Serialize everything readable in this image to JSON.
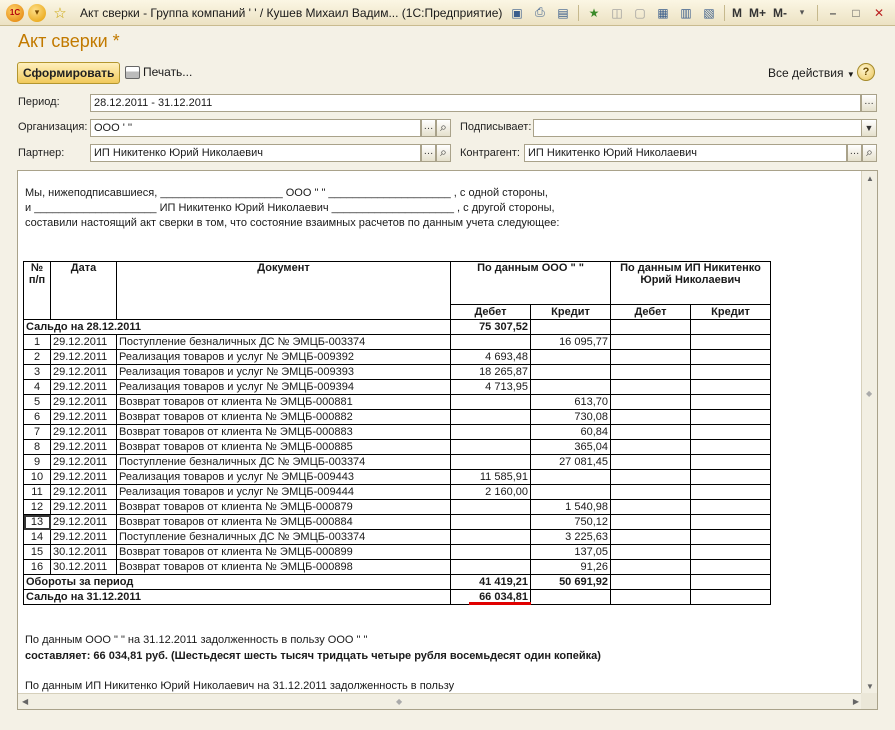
{
  "window": {
    "title": "Акт сверки - Группа компаний '                    ' / Кушев Михаил Вадим...   (1С:Предприятие)",
    "logo_text": "1С",
    "memory_buttons": [
      "M",
      "M+",
      "M-"
    ]
  },
  "form": {
    "title": "Акт сверки *",
    "generate_button": "Сформировать",
    "print_button": "Печать...",
    "all_actions": "Все действия",
    "help": "?"
  },
  "fields": {
    "period_label": "Период:",
    "period_value": "28.12.2011 - 31.12.2011",
    "org_label": "Организация:",
    "org_value": "ООО '                    ''",
    "signer_label": "Подписывает:",
    "signer_value": "",
    "partner_label": "Партнер:",
    "partner_value": "ИП Никитенко Юрий Николаевич",
    "contractor_label": "Контрагент:",
    "contractor_value": "ИП Никитенко Юрий Николаевич"
  },
  "report": {
    "intro": [
      "Мы, нижеподписавшиеся, ____________________ ООО \"                \" ____________________ , с одной стороны,",
      "и ____________________  ИП Никитенко Юрий Николаевич ____________________ , с другой стороны,",
      "составили настоящий акт сверки в том, что состояние взаимных расчетов по данным учета следующее:"
    ],
    "headers": {
      "num": "№ п/п",
      "date": "Дата",
      "doc": "Документ",
      "by_data_1": "По данным ООО \"                \"",
      "by_data_2": "По данным ИП Никитенко Юрий Николаевич",
      "debit": "Дебет",
      "credit": "Кредит"
    },
    "opening": {
      "label": "Сальдо на 28.12.2011",
      "debit": "75 307,52"
    },
    "rows": [
      {
        "n": "1",
        "date": "29.12.2011",
        "doc": "Поступление безналичных ДС  № ЭМЦБ-003374",
        "debit": "",
        "credit": "16 095,77"
      },
      {
        "n": "2",
        "date": "29.12.2011",
        "doc": "Реализация товаров и услуг  № ЭМЦБ-009392",
        "debit": "4 693,48",
        "credit": ""
      },
      {
        "n": "3",
        "date": "29.12.2011",
        "doc": "Реализация товаров и услуг  № ЭМЦБ-009393",
        "debit": "18 265,87",
        "credit": ""
      },
      {
        "n": "4",
        "date": "29.12.2011",
        "doc": "Реализация товаров и услуг  № ЭМЦБ-009394",
        "debit": "4 713,95",
        "credit": ""
      },
      {
        "n": "5",
        "date": "29.12.2011",
        "doc": "Возврат товаров от клиента  № ЭМЦБ-000881",
        "debit": "",
        "credit": "613,70"
      },
      {
        "n": "6",
        "date": "29.12.2011",
        "doc": "Возврат товаров от клиента  № ЭМЦБ-000882",
        "debit": "",
        "credit": "730,08"
      },
      {
        "n": "7",
        "date": "29.12.2011",
        "doc": "Возврат товаров от клиента  № ЭМЦБ-000883",
        "debit": "",
        "credit": "60,84"
      },
      {
        "n": "8",
        "date": "29.12.2011",
        "doc": "Возврат товаров от клиента  № ЭМЦБ-000885",
        "debit": "",
        "credit": "365,04"
      },
      {
        "n": "9",
        "date": "29.12.2011",
        "doc": "Поступление безналичных ДС  № ЭМЦБ-003374",
        "debit": "",
        "credit": "27 081,45"
      },
      {
        "n": "10",
        "date": "29.12.2011",
        "doc": "Реализация товаров и услуг  № ЭМЦБ-009443",
        "debit": "11 585,91",
        "credit": ""
      },
      {
        "n": "11",
        "date": "29.12.2011",
        "doc": "Реализация товаров и услуг  № ЭМЦБ-009444",
        "debit": "2 160,00",
        "credit": ""
      },
      {
        "n": "12",
        "date": "29.12.2011",
        "doc": "Возврат товаров от клиента  № ЭМЦБ-000879",
        "debit": "",
        "credit": "1 540,98"
      },
      {
        "n": "13",
        "date": "29.12.2011",
        "doc": "Возврат товаров от клиента  № ЭМЦБ-000884",
        "debit": "",
        "credit": "750,12"
      },
      {
        "n": "14",
        "date": "29.12.2011",
        "doc": "Поступление безналичных ДС  № ЭМЦБ-003374",
        "debit": "",
        "credit": "3 225,63"
      },
      {
        "n": "15",
        "date": "30.12.2011",
        "doc": "Возврат товаров от клиента  № ЭМЦБ-000899",
        "debit": "",
        "credit": "137,05"
      },
      {
        "n": "16",
        "date": "30.12.2011",
        "doc": "Возврат товаров от клиента  № ЭМЦБ-000898",
        "debit": "",
        "credit": "91,26"
      }
    ],
    "turnover": {
      "label": "Обороты за период",
      "debit": "41 419,21",
      "credit": "50 691,92"
    },
    "closing": {
      "label": "Сальдо на 31.12.2011",
      "debit": "66 034,81"
    },
    "footer": [
      "По данным ООО \"                \" на 31.12.2011 задолженность в пользу ООО \"                \"",
      "составляет: 66 034,81 руб. (Шестьдесят шесть тысяч тридцать четыре рубля восемьдесят один копейка)",
      "По данным ИП Никитенко Юрий Николаевич на 31.12.2011 задолженность в пользу"
    ]
  },
  "colors": {
    "title_accent": "#c27a00",
    "highlight_line": "#e00000",
    "window_bg": "#f4f1e6"
  }
}
